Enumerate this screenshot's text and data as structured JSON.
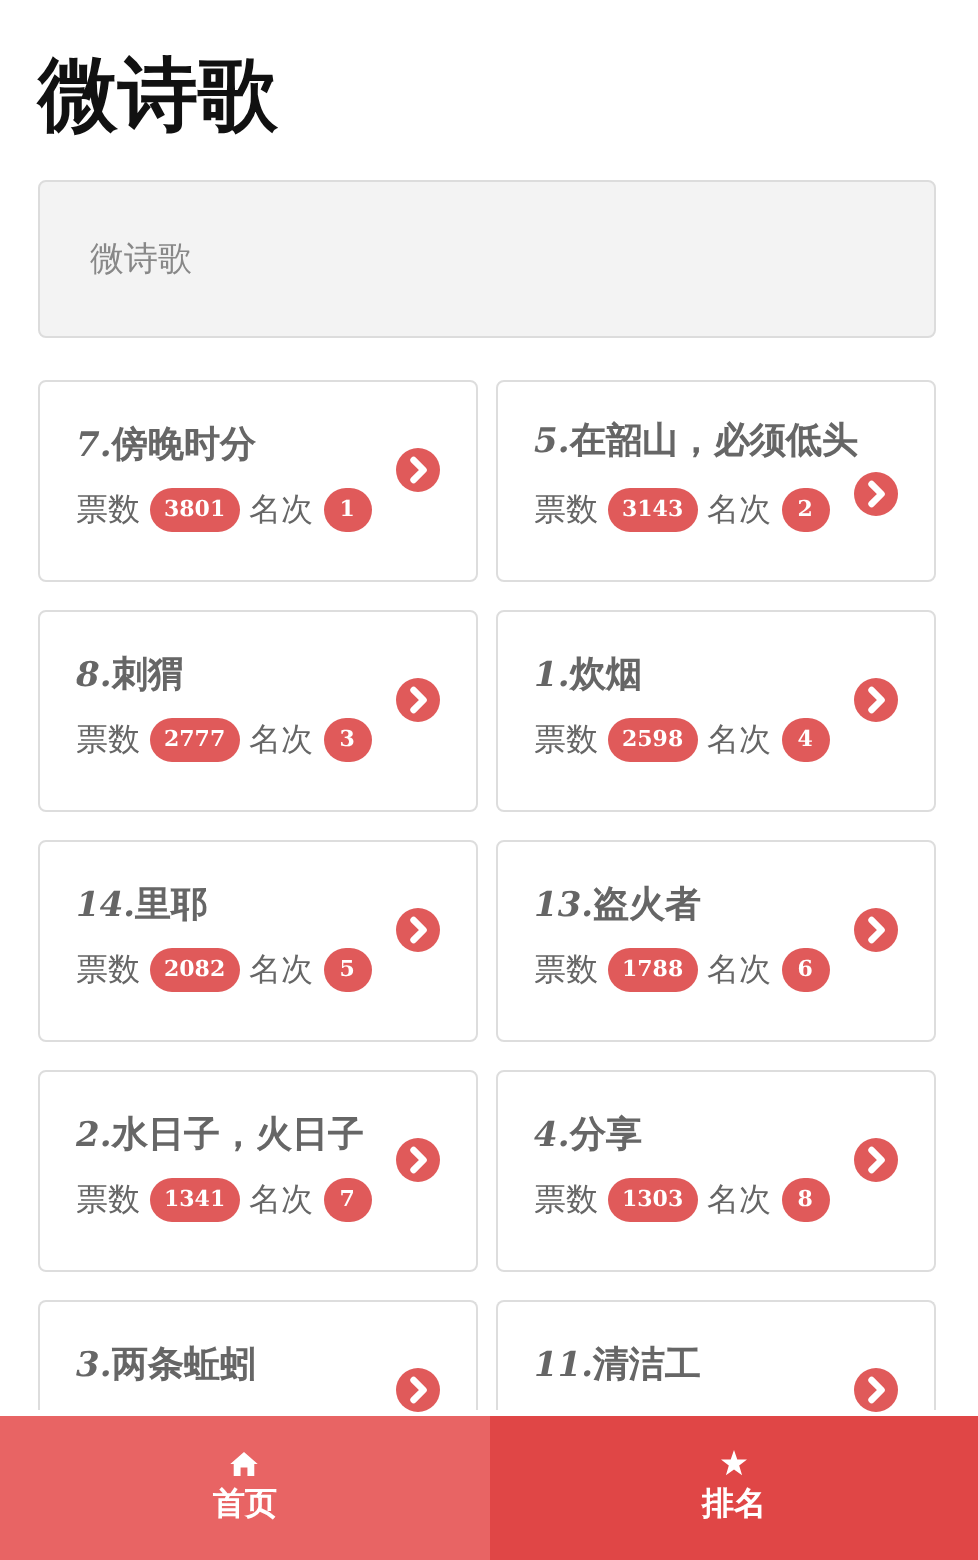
{
  "title": "微诗歌",
  "search": {
    "placeholder": "微诗歌"
  },
  "poems": [
    {
      "number": "7.",
      "name": "傍晚时分",
      "votes_label": "票数",
      "votes": "3801",
      "rank_label": "名次",
      "rank": "1"
    },
    {
      "number": "5.",
      "name": "在韶山，必须低头",
      "votes_label": "票数",
      "votes": "3143",
      "rank_label": "名次",
      "rank": "2"
    },
    {
      "number": "8.",
      "name": "刺猬",
      "votes_label": "票数",
      "votes": "2777",
      "rank_label": "名次",
      "rank": "3"
    },
    {
      "number": "1.",
      "name": "炊烟",
      "votes_label": "票数",
      "votes": "2598",
      "rank_label": "名次",
      "rank": "4"
    },
    {
      "number": "14.",
      "name": "里耶",
      "votes_label": "票数",
      "votes": "2082",
      "rank_label": "名次",
      "rank": "5"
    },
    {
      "number": "13.",
      "name": "盗火者",
      "votes_label": "票数",
      "votes": "1788",
      "rank_label": "名次",
      "rank": "6"
    },
    {
      "number": "2.",
      "name": "水日子，火日子",
      "votes_label": "票数",
      "votes": "1341",
      "rank_label": "名次",
      "rank": "7"
    },
    {
      "number": "4.",
      "name": "分享",
      "votes_label": "票数",
      "votes": "1303",
      "rank_label": "名次",
      "rank": "8"
    },
    {
      "number": "3.",
      "name": "两条蚯蚓"
    },
    {
      "number": "11.",
      "name": "清洁工"
    }
  ],
  "tab_bar": [
    {
      "kind": "home",
      "label": "首页",
      "selected": false
    },
    {
      "kind": "star",
      "label": "排名",
      "selected": true
    }
  ]
}
